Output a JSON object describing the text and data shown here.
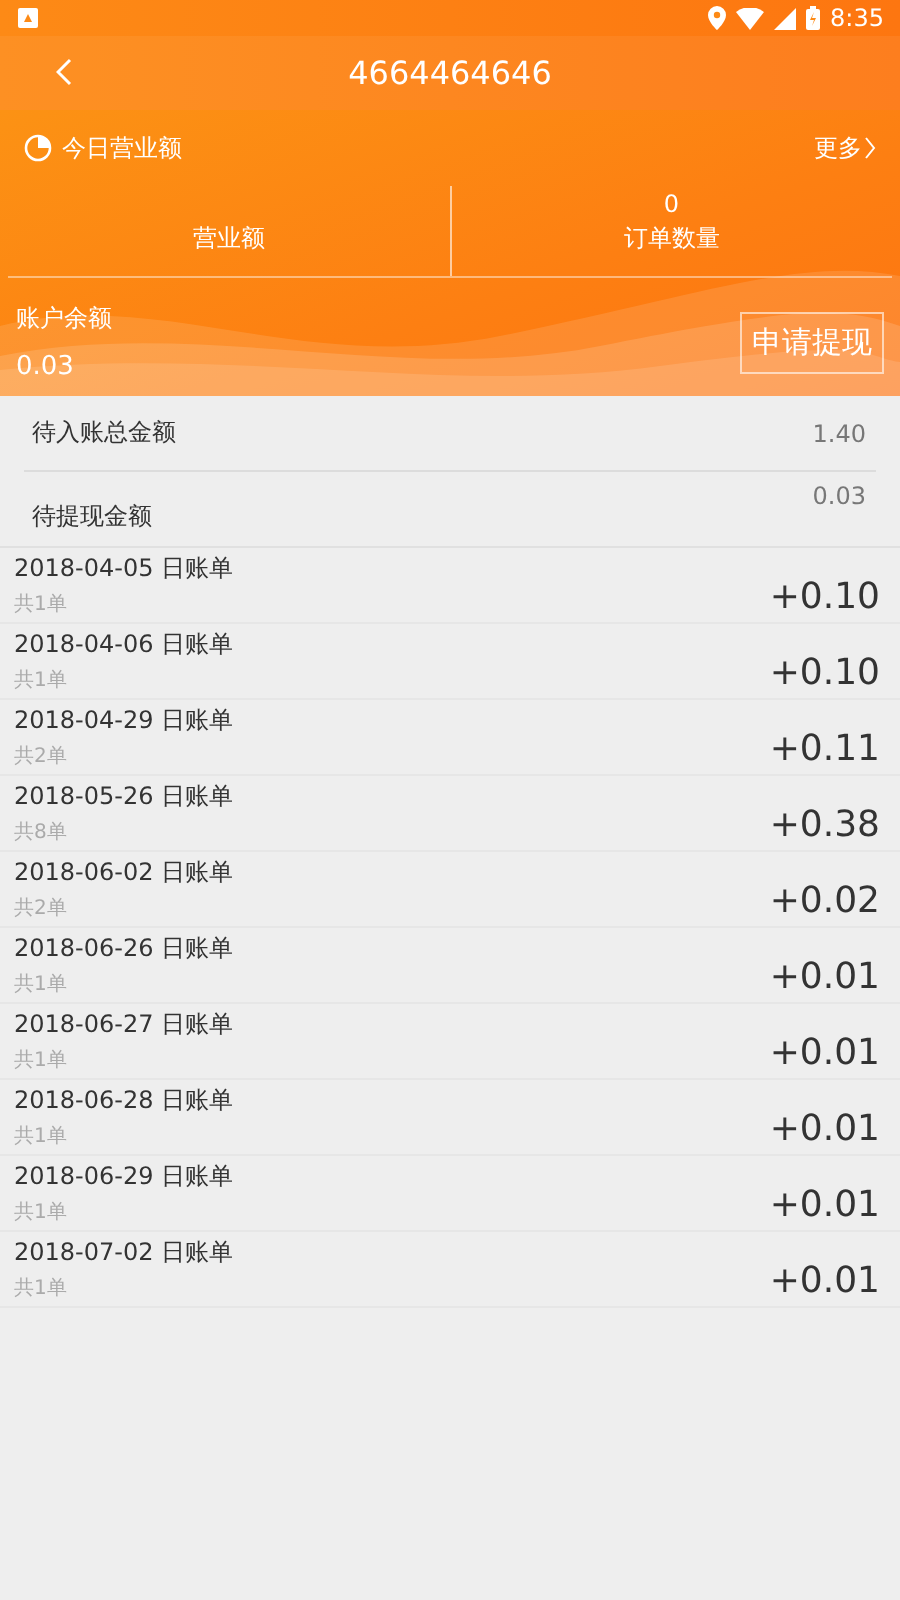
{
  "status_bar": {
    "time": "8:35"
  },
  "header": {
    "title": "4664464646"
  },
  "today": {
    "title": "今日营业额",
    "more": "更多",
    "stats": [
      {
        "label": "营业额"
      },
      {
        "value": "0",
        "label": "订单数量"
      }
    ]
  },
  "balance": {
    "label": "账户余额",
    "value": "0.03",
    "button": "申请提现"
  },
  "summary": [
    {
      "label": "待入账总金额",
      "value": "1.40"
    },
    {
      "label": "待提现金额",
      "value": "0.03"
    }
  ],
  "bills": [
    {
      "title": "2018-04-05 日账单",
      "count": "共1单",
      "amount": "+0.10"
    },
    {
      "title": "2018-04-06 日账单",
      "count": "共1单",
      "amount": "+0.10"
    },
    {
      "title": "2018-04-29 日账单",
      "count": "共2单",
      "amount": "+0.11"
    },
    {
      "title": "2018-05-26 日账单",
      "count": "共8单",
      "amount": "+0.38"
    },
    {
      "title": "2018-06-02 日账单",
      "count": "共2单",
      "amount": "+0.02"
    },
    {
      "title": "2018-06-26 日账单",
      "count": "共1单",
      "amount": "+0.01"
    },
    {
      "title": "2018-06-27 日账单",
      "count": "共1单",
      "amount": "+0.01"
    },
    {
      "title": "2018-06-28 日账单",
      "count": "共1单",
      "amount": "+0.01"
    },
    {
      "title": "2018-06-29 日账单",
      "count": "共1单",
      "amount": "+0.01"
    },
    {
      "title": "2018-07-02 日账单",
      "count": "共1单",
      "amount": "+0.01"
    }
  ]
}
